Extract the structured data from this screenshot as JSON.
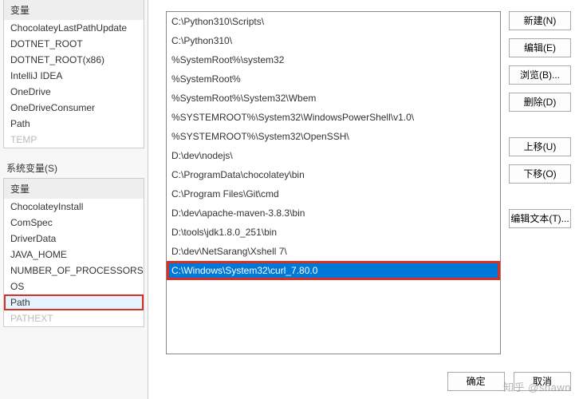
{
  "leftPanel": {
    "userVars": {
      "header": "变量",
      "items": [
        "ChocolateyLastPathUpdate",
        "DOTNET_ROOT",
        "DOTNET_ROOT(x86)",
        "IntelliJ IDEA",
        "OneDrive",
        "OneDriveConsumer",
        "Path",
        "TEMP"
      ]
    },
    "sysLabel": "系统变量(S)",
    "sysVars": {
      "header": "变量",
      "items": [
        "ChocolateyInstall",
        "ComSpec",
        "DriverData",
        "JAVA_HOME",
        "NUMBER_OF_PROCESSORS",
        "OS",
        "Path",
        "PATHEXT"
      ],
      "selectedIndex": 6,
      "highlightIndex": 6
    }
  },
  "pathList": {
    "entries": [
      "C:\\Python310\\Scripts\\",
      "C:\\Python310\\",
      "%SystemRoot%\\system32",
      "%SystemRoot%",
      "%SystemRoot%\\System32\\Wbem",
      "%SYSTEMROOT%\\System32\\WindowsPowerShell\\v1.0\\",
      "%SYSTEMROOT%\\System32\\OpenSSH\\",
      "D:\\dev\\nodejs\\",
      "C:\\ProgramData\\chocolatey\\bin",
      "C:\\Program Files\\Git\\cmd",
      "D:\\dev\\apache-maven-3.8.3\\bin",
      "D:\\tools\\jdk1.8.0_251\\bin",
      "D:\\dev\\NetSarang\\Xshell 7\\",
      "C:\\Windows\\System32\\curl_7.80.0"
    ],
    "selectedIndex": 13,
    "highlightIndex": 13
  },
  "buttons": {
    "new": "新建(N)",
    "edit": "编辑(E)",
    "browse": "浏览(B)...",
    "delete": "删除(D)",
    "moveUp": "上移(U)",
    "moveDown": "下移(O)",
    "editText": "编辑文本(T)...",
    "ok": "确定",
    "cancel": "取消"
  },
  "watermark": "知乎 @shawn"
}
